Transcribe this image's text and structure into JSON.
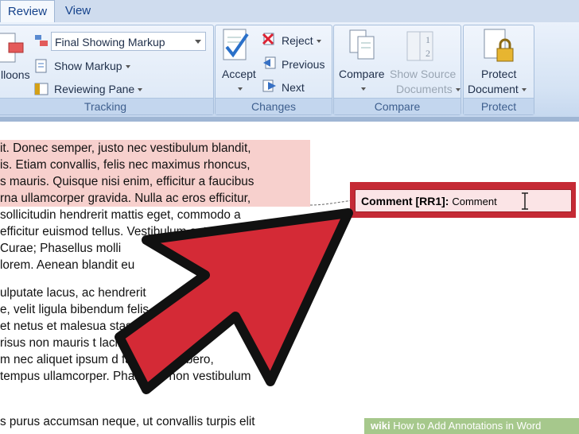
{
  "tabs": [
    {
      "label": "Review"
    },
    {
      "label": "View"
    }
  ],
  "tracking": {
    "balloons_label": "lloons",
    "markup_select": "Final Showing Markup",
    "show_markup": "Show Markup",
    "reviewing_pane": "Reviewing Pane",
    "group_label": "Tracking"
  },
  "changes": {
    "accept": "Accept",
    "reject": "Reject",
    "previous": "Previous",
    "next": "Next",
    "group_label": "Changes"
  },
  "compare": {
    "compare": "Compare",
    "show_source_1": "Show Source",
    "show_source_2": "Documents",
    "group_label": "Compare"
  },
  "protect": {
    "protect_1": "Protect",
    "protect_2": "Document",
    "group_label": "Protect"
  },
  "document": {
    "lines": [
      "it. Donec semper, justo nec vestibulum blandit,",
      "is. Etiam convallis, felis nec maximus rhoncus,",
      "s mauris. Quisque nisi enim, efficitur a faucibus",
      "rna ullamcorper gravida. Nulla ac eros efficitur,",
      " sollicitudin hendrerit mattis eget, commodo a",
      " efficitur euismod tellus. Vestibulum ante",
      " Curae; Phasellus molli",
      " lorem. Aenean blandit eu",
      "ulputate lacus, ac hendrerit",
      "e, velit ligula bibendum            felis",
      "et netus et malesua                   stas.",
      " risus non mauris t        lacinia    que orci",
      "m nec aliquet ipsum        d faucibus o libero,",
      " tempus ullamcorper. Phasellus non vestibulum",
      "s purus accumsan neque, ut convallis turpis elit"
    ]
  },
  "comment": {
    "tag": "Comment [RR1]:",
    "text": "Comment"
  },
  "watermark": {
    "brand": "wiki",
    "title": "How to Add Annotations in Word"
  }
}
